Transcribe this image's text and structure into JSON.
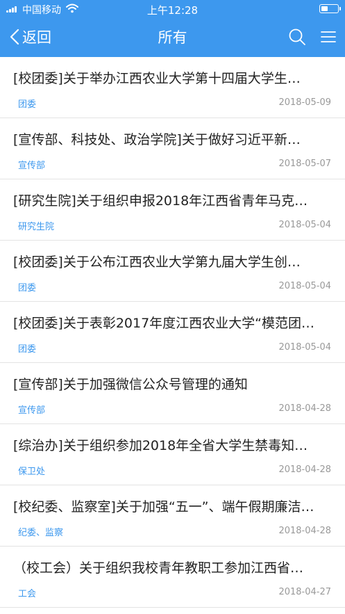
{
  "status_bar": {
    "carrier": "中国移动",
    "time": "上午12:28"
  },
  "nav": {
    "back_label": "返回",
    "title": "所有",
    "icons": [
      "search-icon",
      "menu-icon",
      "chevron-left-icon"
    ]
  },
  "colors": {
    "header_bg": "#3d98ee",
    "tag": "#3d98ee",
    "date": "#999999",
    "title_text": "#222222"
  },
  "notices": [
    {
      "title": "[校团委]关于举办江西农业大学第十四届大学生…",
      "department": "团委",
      "date": "2018-05-09"
    },
    {
      "title": "[宣传部、科技处、政治学院]关于做好习近平新…",
      "department": "宣传部",
      "date": "2018-05-07"
    },
    {
      "title": "[研究生院]关于组织申报2018年江西省青年马克…",
      "department": "研究生院",
      "date": "2018-05-04"
    },
    {
      "title": "[校团委]关于公布江西农业大学第九届大学生创…",
      "department": "团委",
      "date": "2018-05-04"
    },
    {
      "title": "[校团委]关于表彰2017年度江西农业大学“模范团…",
      "department": "团委",
      "date": "2018-05-04"
    },
    {
      "title": "[宣传部]关于加强微信公众号管理的通知",
      "department": "宣传部",
      "date": "2018-04-28"
    },
    {
      "title": "[综治办]关于组织参加2018年全省大学生禁毒知…",
      "department": "保卫处",
      "date": "2018-04-28"
    },
    {
      "title": "[校纪委、监察室]关于加强“五一”、端午假期廉洁…",
      "department": "纪委、监察",
      "date": "2018-04-28"
    },
    {
      "title": "（校工会）关于组织我校青年教职工参加江西省…",
      "department": "工会",
      "date": "2018-04-27"
    }
  ]
}
